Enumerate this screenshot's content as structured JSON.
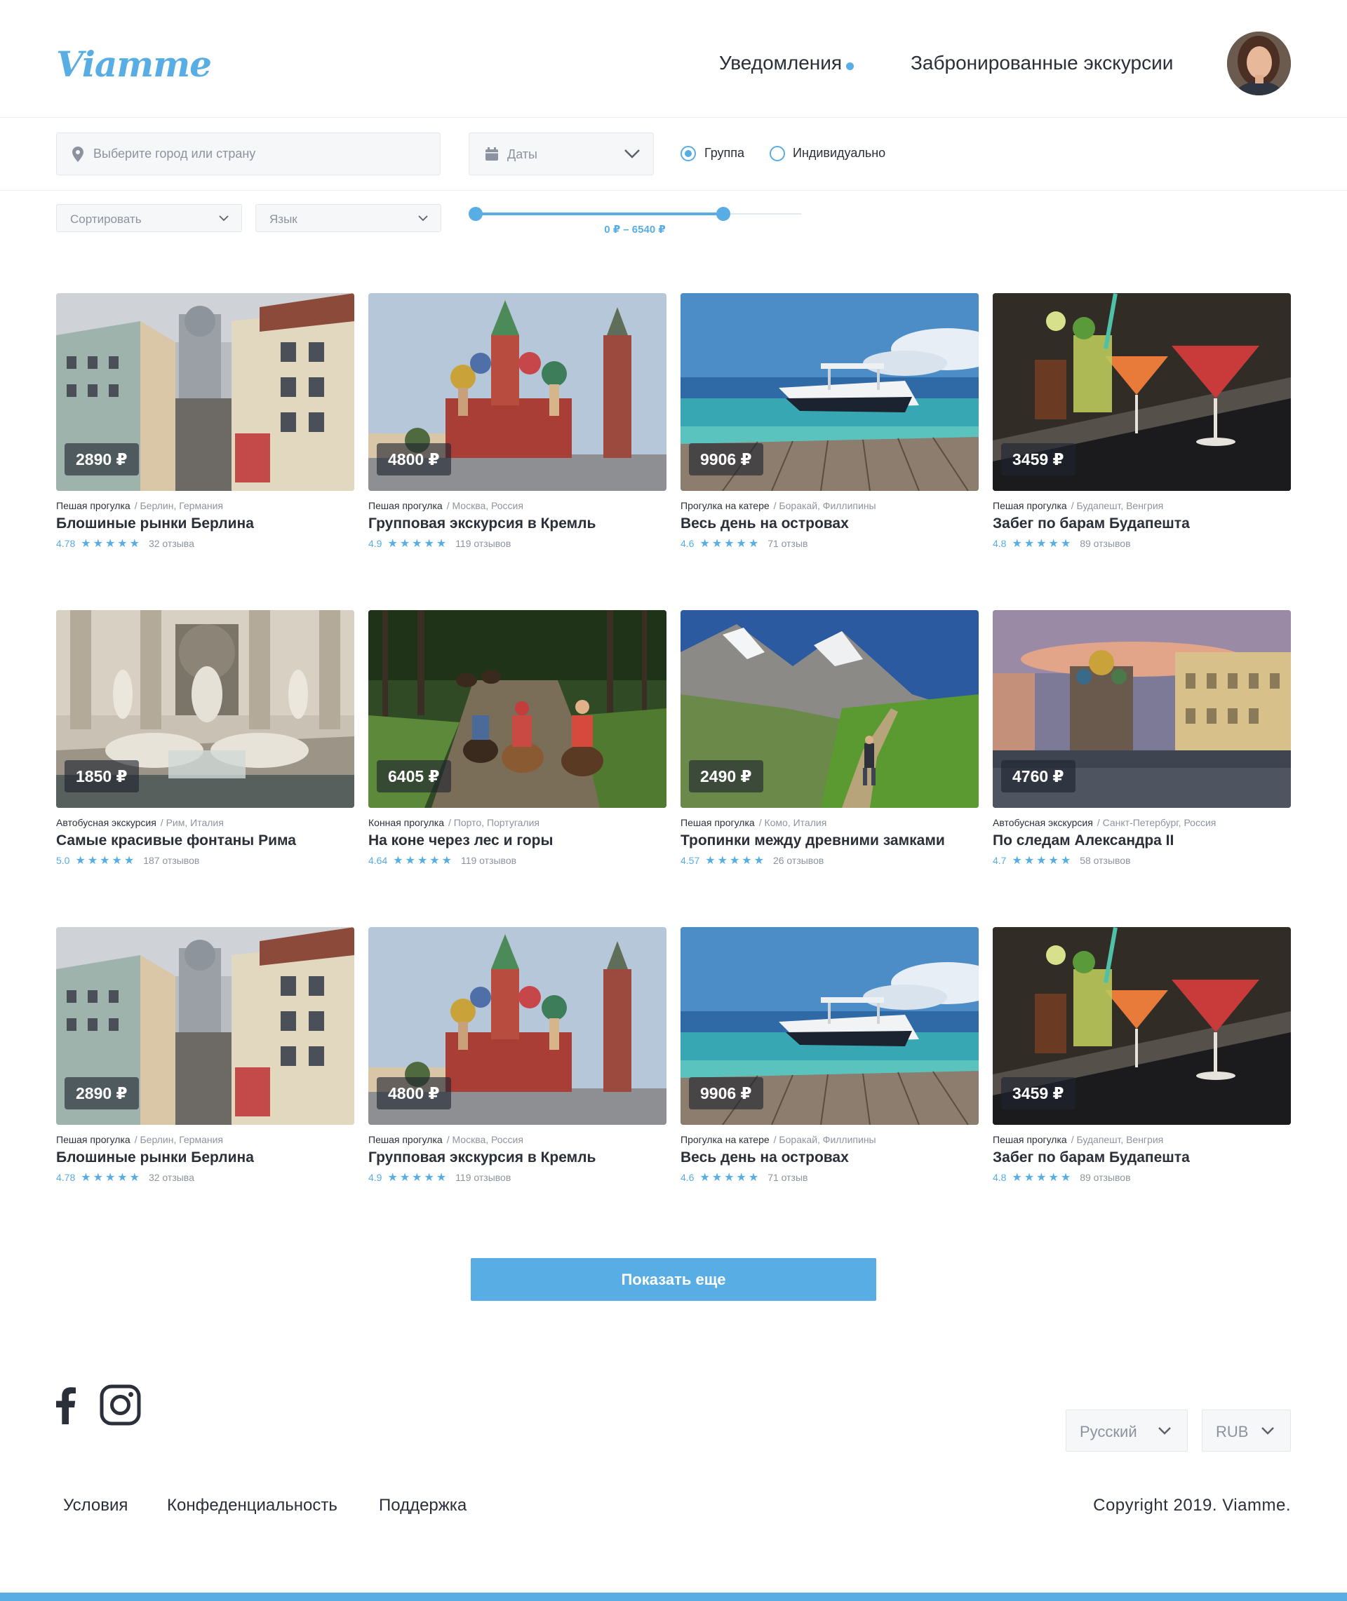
{
  "header": {
    "logo": "Viamme",
    "notifications_label": "Уведомления",
    "booked_label": "Забронированные экскурсии"
  },
  "filters": {
    "search_placeholder": "Выберите город или страну",
    "dates_label": "Даты",
    "radio_group": "Группа",
    "radio_individual": "Индивидуально",
    "radio_selected": "Группа",
    "sort_label": "Сортировать",
    "language_label": "Язык",
    "price_range_text": "0 ₽ – 6540 ₽",
    "price_min_fraction": 0.0,
    "price_max_fraction": 0.76
  },
  "cards": [
    {
      "price": "2890 ₽",
      "type": "Пешая прогулка",
      "location": "/ Берлин, Германия",
      "title": "Блошиные рынки Берлина",
      "rating": "4.78",
      "reviews": "32 отзыва",
      "image": "berlin-street"
    },
    {
      "price": "4800 ₽",
      "type": "Пешая прогулка",
      "location": "/ Москва, Россия",
      "title": "Групповая экскурсия в Кремль",
      "rating": "4.9",
      "reviews": "119 отзывов",
      "image": "moscow-cathedral"
    },
    {
      "price": "9906 ₽",
      "type": "Прогулка на катере",
      "location": "/ Боракай, Филлипины",
      "title": "Весь день на островах",
      "rating": "4.6",
      "reviews": "71 отзыв",
      "image": "boat-sea"
    },
    {
      "price": "3459 ₽",
      "type": "Пешая прогулка",
      "location": "/ Будапешт, Венгрия",
      "title": "Забег по барам Будапешта",
      "rating": "4.8",
      "reviews": "89 отзывов",
      "image": "cocktails"
    },
    {
      "price": "1850 ₽",
      "type": "Автобусная экскурсия",
      "location": "/ Рим, Италия",
      "title": "Самые красивые фонтаны Рима",
      "rating": "5.0",
      "reviews": "187 отзывов",
      "image": "trevi-fountain"
    },
    {
      "price": "6405 ₽",
      "type": "Конная прогулка",
      "location": "/ Порто, Португалия",
      "title": "На коне через лес и горы",
      "rating": "4.64",
      "reviews": "119 отзывов",
      "image": "horse-forest"
    },
    {
      "price": "2490 ₽",
      "type": "Пешая прогулка",
      "location": "/ Комо, Италия",
      "title": "Тропинки между древними замками",
      "rating": "4.57",
      "reviews": "26 отзывов",
      "image": "mountain-hike"
    },
    {
      "price": "4760 ₽",
      "type": "Автобусная экскурсия",
      "location": "/ Санкт-Петербург, Россия",
      "title": "По следам Александра II",
      "rating": "4.7",
      "reviews": "58 отзывов",
      "image": "spb-canal"
    },
    {
      "price": "2890 ₽",
      "type": "Пешая прогулка",
      "location": "/ Берлин, Германия",
      "title": "Блошиные рынки Берлина",
      "rating": "4.78",
      "reviews": "32 отзыва",
      "image": "berlin-street"
    },
    {
      "price": "4800 ₽",
      "type": "Пешая прогулка",
      "location": "/ Москва, Россия",
      "title": "Групповая экскурсия в Кремль",
      "rating": "4.9",
      "reviews": "119 отзывов",
      "image": "moscow-cathedral"
    },
    {
      "price": "9906 ₽",
      "type": "Прогулка на катере",
      "location": "/ Боракай, Филлипины",
      "title": "Весь день на островах",
      "rating": "4.6",
      "reviews": "71 отзыв",
      "image": "boat-sea"
    },
    {
      "price": "3459 ₽",
      "type": "Пешая прогулка",
      "location": "/ Будапешт, Венгрия",
      "title": "Забег по барам Будапешта",
      "rating": "4.8",
      "reviews": "89 отзывов",
      "image": "cocktails"
    }
  ],
  "stars": "★★★★★",
  "show_more_label": "Показать еще",
  "footer": {
    "language": "Русский",
    "currency": "RUB",
    "links": [
      "Условия",
      "Конфеденциальность",
      "Поддержка"
    ],
    "copyright": "Copyright 2019. Viamme."
  },
  "colors": {
    "accent": "#57ade4",
    "text": "#2b2f3a",
    "muted": "#8d939e"
  }
}
